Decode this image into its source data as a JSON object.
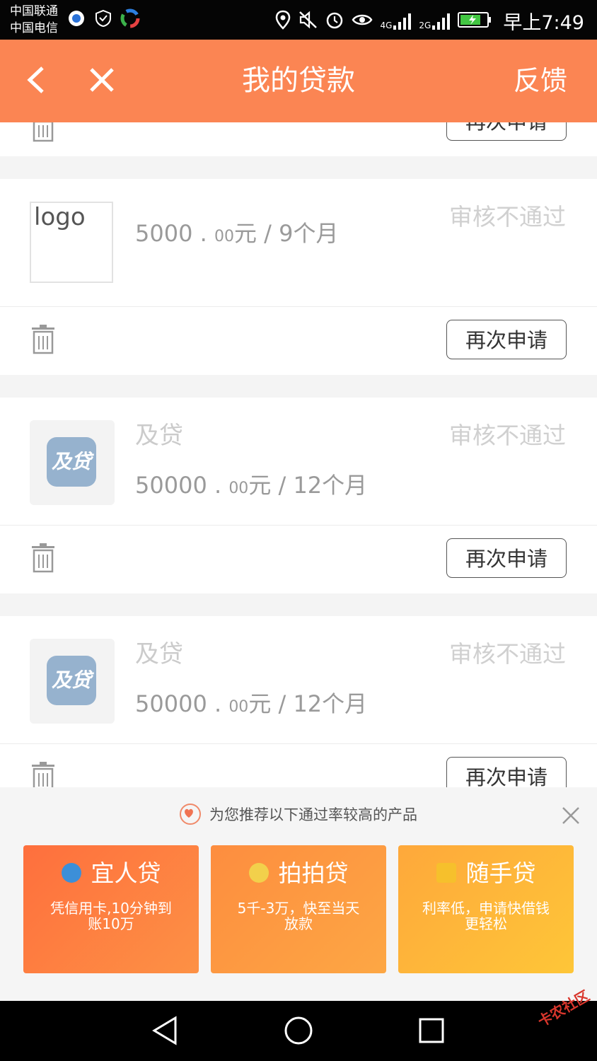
{
  "status_bar": {
    "carrier_1": "中国联通",
    "carrier_2": "中国电信",
    "network_1": "4G",
    "network_2": "2G",
    "time": "早上7:49"
  },
  "header": {
    "title": "我的贷款",
    "feedback_label": "反馈"
  },
  "loans": [
    {
      "logo_text": "logo",
      "name": "",
      "amount_int": "5000",
      "amount_dec": "00",
      "unit_term": "元 / 9个月",
      "status": "审核不通过",
      "reapply_label": "再次申请"
    },
    {
      "logo_text": "及贷",
      "name": "及贷",
      "amount_int": "50000",
      "amount_dec": "00",
      "unit_term": "元 / 12个月",
      "status": "审核不通过",
      "reapply_label": "再次申请"
    },
    {
      "logo_text": "及贷",
      "name": "及贷",
      "amount_int": "50000",
      "amount_dec": "00",
      "unit_term": "元 / 12个月",
      "status": "审核不通过",
      "reapply_label": "再次申请"
    }
  ],
  "recommend": {
    "title": "为您推荐以下通过率较高的产品",
    "products": [
      {
        "name": "宜人贷",
        "desc": "凭信用卡,10分钟到账10万"
      },
      {
        "name": "拍拍贷",
        "desc": "5千-3万，快至当天放款"
      },
      {
        "name": "随手贷",
        "desc": "利率低，申请快借钱更轻松"
      }
    ]
  },
  "watermark": "卡农社区",
  "colors": {
    "accent": "#fb8553",
    "status_text": "#d0d0d0"
  }
}
